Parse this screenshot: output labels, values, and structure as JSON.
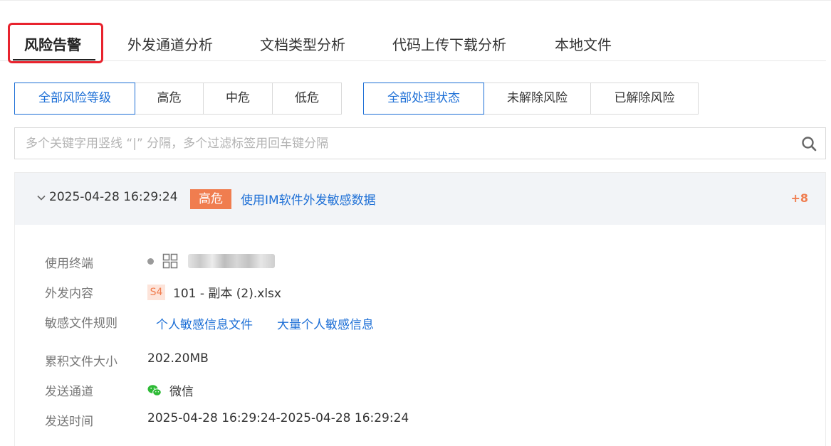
{
  "tabs": [
    {
      "label": "风险告警",
      "active": true
    },
    {
      "label": "外发通道分析"
    },
    {
      "label": "文档类型分析"
    },
    {
      "label": "代码上传下载分析"
    },
    {
      "label": "本地文件"
    }
  ],
  "risk_filters": [
    "全部风险等级",
    "高危",
    "中危",
    "低危"
  ],
  "status_filters": [
    "全部处理状态",
    "未解除风险",
    "已解除风险"
  ],
  "search": {
    "placeholder": "多个关键字用竖线 “|” 分隔，多个过滤标签用回车键分隔",
    "icon": "search-icon"
  },
  "alert": {
    "time": "2025-04-28 16:29:24",
    "severity": "高危",
    "title": "使用IM软件外发敏感数据",
    "count": "+8",
    "details": {
      "terminal_label": "使用终端",
      "terminal_os_icon": "windows-icon",
      "content_label": "外发内容",
      "content_level": "S4",
      "content_file": "101 - 副本 (2).xlsx",
      "rules_label": "敏感文件规则",
      "rules": [
        "个人敏感信息文件",
        "大量个人敏感信息"
      ],
      "size_label": "累积文件大小",
      "size_value": "202.20MB",
      "channel_label": "发送通道",
      "channel_icon": "wechat-icon",
      "channel_value": "微信",
      "time_label": "发送时间",
      "time_value": "2025-04-28 16:29:24-2025-04-28 16:29:24"
    }
  },
  "colors": {
    "accent": "#1d6fd6",
    "severity": "#f07d4f",
    "highlight": "#e8232e"
  }
}
